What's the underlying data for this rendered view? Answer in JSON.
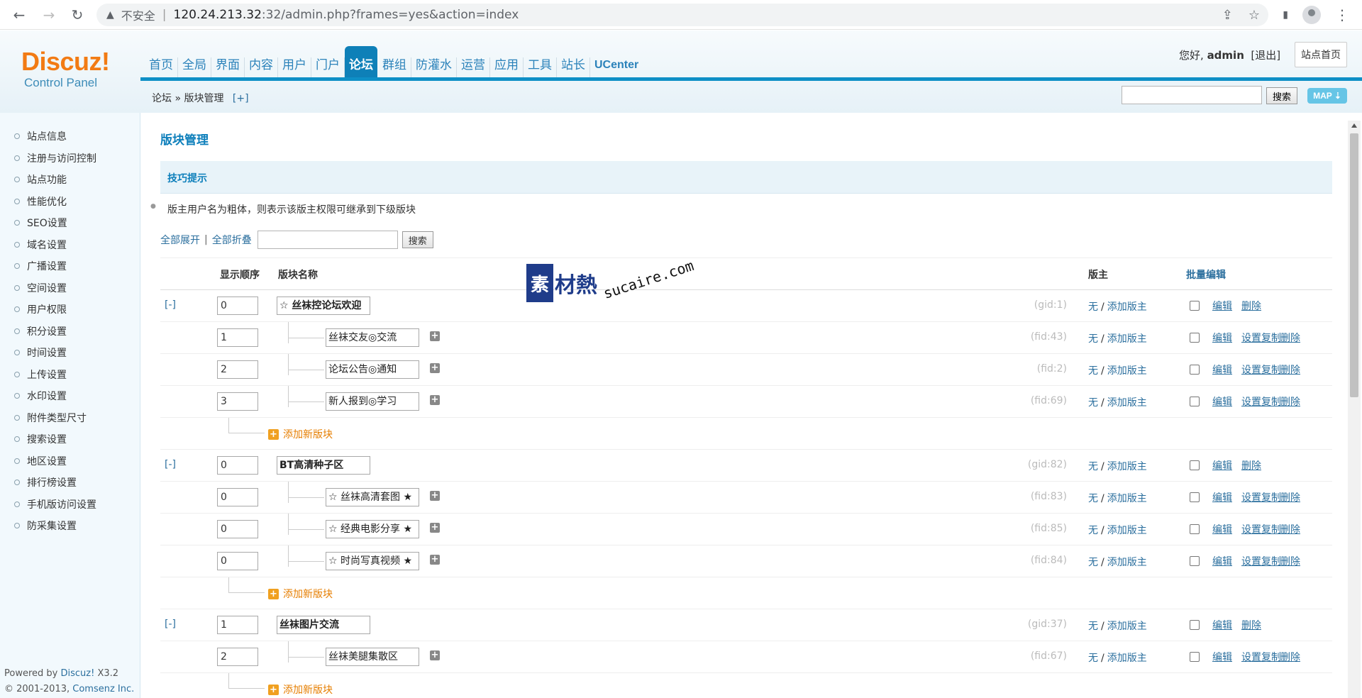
{
  "browser": {
    "insecure_label": "不安全",
    "url_host": "120.24.213.32",
    "url_rest": ":32/admin.php?frames=yes&action=index"
  },
  "header": {
    "logo_main": "Discuz!",
    "logo_sub": "Control Panel",
    "nav": [
      "首页",
      "全局",
      "界面",
      "内容",
      "用户",
      "门户",
      "论坛",
      "群组",
      "防灌水",
      "运营",
      "应用",
      "工具",
      "站长",
      "UCenter"
    ],
    "active_nav": "论坛",
    "greeting": "您好,",
    "username": "admin",
    "logout": "[退出]",
    "site_home": "站点首页",
    "breadcrumb": "论坛 » 版块管理",
    "breadcrumb_plus": "[+]",
    "search_btn": "搜索",
    "map_btn": "MAP ⇣"
  },
  "sidebar": {
    "items": [
      "站点信息",
      "注册与访问控制",
      "站点功能",
      "性能优化",
      "SEO设置",
      "域名设置",
      "广播设置",
      "空间设置",
      "用户权限",
      "积分设置",
      "时间设置",
      "上传设置",
      "水印设置",
      "附件类型尺寸",
      "搜索设置",
      "地区设置",
      "排行榜设置",
      "手机版访问设置",
      "防采集设置"
    ],
    "powered_prefix": "Powered by ",
    "powered_link": "Discuz!",
    "powered_version": " X3.2",
    "copyright_prefix": "© 2001-2013, ",
    "copyright_link": "Comsenz Inc."
  },
  "main": {
    "title": "版块管理",
    "tips_title": "技巧提示",
    "tip": "版主用户名为粗体，则表示该版主权限可继承到下级版块",
    "expand_all": "全部展开",
    "divider": "|",
    "collapse_all": "全部折叠",
    "search_btn": "搜索",
    "columns": {
      "order": "显示顺序",
      "name": "版块名称",
      "moderator": "版主",
      "batch_edit": "批量编辑"
    },
    "toggle": "[-]",
    "mod_none": "无",
    "mod_sep": "/",
    "mod_add": "添加版主",
    "edit": "编辑",
    "copy": "设置复制",
    "delete": "删除",
    "add_new": "添加新版块",
    "groups": [
      {
        "order": "0",
        "name": "☆ 丝袜控论坛欢迎",
        "id": "(gid:1)",
        "forums": [
          {
            "order": "1",
            "name": "丝袜交友◎交流",
            "id": "(fid:43)"
          },
          {
            "order": "2",
            "name": "论坛公告◎通知",
            "id": "(fid:2)"
          },
          {
            "order": "3",
            "name": "新人报到◎学习",
            "id": "(fid:69)"
          }
        ]
      },
      {
        "order": "0",
        "name": "BT高清种子区",
        "id": "(gid:82)",
        "forums": [
          {
            "order": "0",
            "name": "☆ 丝袜高清套图 ★",
            "id": "(fid:83)"
          },
          {
            "order": "0",
            "name": "☆ 经典电影分享 ★",
            "id": "(fid:85)"
          },
          {
            "order": "0",
            "name": "☆ 时尚写真视频 ★",
            "id": "(fid:84)"
          }
        ]
      },
      {
        "order": "1",
        "name": "丝袜图片交流",
        "id": "(gid:37)",
        "forums": [
          {
            "order": "2",
            "name": "丝袜美腿集散区",
            "id": "(fid:67)"
          }
        ]
      }
    ]
  },
  "watermark": {
    "box": "素",
    "text": "材熱",
    "url": "sucaire.com"
  }
}
